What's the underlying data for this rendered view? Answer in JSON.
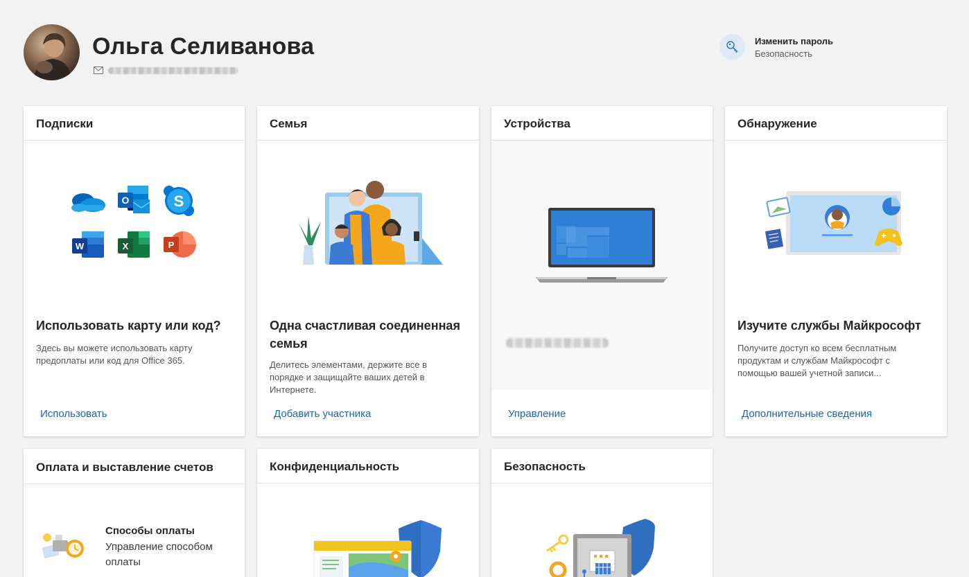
{
  "profile": {
    "name": "Ольга Селиванова",
    "change_password": "Изменить пароль",
    "change_password_sub": "Безопасность"
  },
  "cards": {
    "subscriptions": {
      "title": "Подписки",
      "heading": "Использовать карту или код?",
      "desc": "Здесь вы можете использовать карту предоплаты или код для Office 365.",
      "link": "Использовать"
    },
    "family": {
      "title": "Семья",
      "heading": "Одна счастливая соединенная семья",
      "desc": "Делитесь элементами, держите все в порядке и защищайте ваших детей в Интернете.",
      "link": "Добавить участника"
    },
    "devices": {
      "title": "Устройства",
      "link": "Управление"
    },
    "discover": {
      "title": "Обнаружение",
      "heading": "Изучите службы Майкрософт",
      "desc": "Получите доступ ко всем бесплатным продуктам и службам Майкрософт с помощью вашей учетной записи...",
      "link": "Дополнительные сведения"
    },
    "payment": {
      "title": "Оплата и выставление счетов",
      "item_title": "Способы оплаты",
      "item_sub": "Управление способом оплаты"
    },
    "privacy": {
      "title": "Конфиденциальность"
    },
    "security": {
      "title": "Безопасность"
    }
  },
  "colors": {
    "link": "#1b64b3",
    "background": "#f2f2f2",
    "card": "#ffffff"
  }
}
